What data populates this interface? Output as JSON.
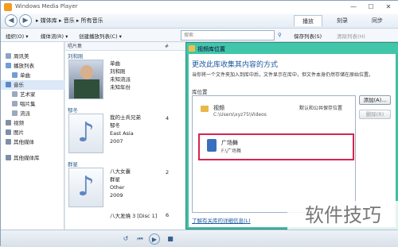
{
  "window": {
    "title": "Windows Media Player",
    "min": "—",
    "max": "☐",
    "close": "✕"
  },
  "nav": {
    "back": "◀",
    "forward": "▶",
    "breadcrumb": "▸ 媒体库 ▸ 音乐 ▸ 所有音乐"
  },
  "tabs": [
    {
      "label": "播放"
    },
    {
      "label": "刻录"
    },
    {
      "label": "同步"
    }
  ],
  "toolbar": {
    "organize": "组织(O) ▾",
    "stream": "媒体流(R) ▾",
    "create_playlist": "创建播放列表(C) ▾",
    "search_placeholder": "搜索",
    "save_list": "保存列表(S)",
    "clear_list": "清除列表(H)"
  },
  "leftnav": {
    "items": [
      {
        "label": "周讯美",
        "color": "#8da5c3"
      },
      {
        "label": "播放列表",
        "color": "#6f9fd6"
      },
      {
        "label": "单曲",
        "color": "#6f9fd6"
      },
      {
        "label": "音乐",
        "color": "#5c8ac4"
      },
      {
        "label": "艺术家",
        "color": "#9aa9bb"
      },
      {
        "label": "唱片集",
        "color": "#9aa9bb"
      },
      {
        "label": "流派",
        "color": "#9aa9bb"
      },
      {
        "label": "视频",
        "color": "#7d8fa6"
      },
      {
        "label": "图片",
        "color": "#7d8fa6"
      },
      {
        "label": "其他媒体",
        "color": "#7d8fa6"
      },
      {
        "label": "其他媒体库",
        "color": "#7d8fa6"
      }
    ]
  },
  "content": {
    "header": "唱片集",
    "header_col2": "#",
    "groups": [
      {
        "artist": "刘和刚",
        "title": "单曲",
        "line2": "刘和刚",
        "line3": "未知流派",
        "line4": "未知年份",
        "num": ""
      },
      {
        "artist": "郁冬",
        "title": "我的士兵兄弟",
        "line2": "郁冬",
        "line3": "East Asia",
        "line4": "2007",
        "num": "4"
      },
      {
        "artist": "群星",
        "title": "八大女囊",
        "line2": "群星",
        "line3": "Other",
        "line4": "2009",
        "num": "2"
      }
    ],
    "last_row": "八大发燒 3 [Disc 1]",
    "last_num": "6"
  },
  "dialog": {
    "title": "视频库位置",
    "heading": "更改此库收集其内容的方式",
    "desc": "当你将一个文件夹加入到库中后，文件显示在库中，但文件本身仍然存储在原始位置。",
    "lib_label": "库位置",
    "locations": [
      {
        "name": "视频",
        "path": "C:\\Users\\xyz75\\Videos",
        "note": "默认和公共保存位置"
      },
      {
        "name": "广场舞",
        "path": "F:\\广场舞",
        "note": ""
      }
    ],
    "add_button": "添加(A)...",
    "delete_button": "删除(R)",
    "link": "了解有关库的详细信息(L)"
  },
  "playbar": {
    "shuffle": "↺",
    "prev": "⏮",
    "play": "▶",
    "stop": "■"
  },
  "watermark": "软件技巧"
}
